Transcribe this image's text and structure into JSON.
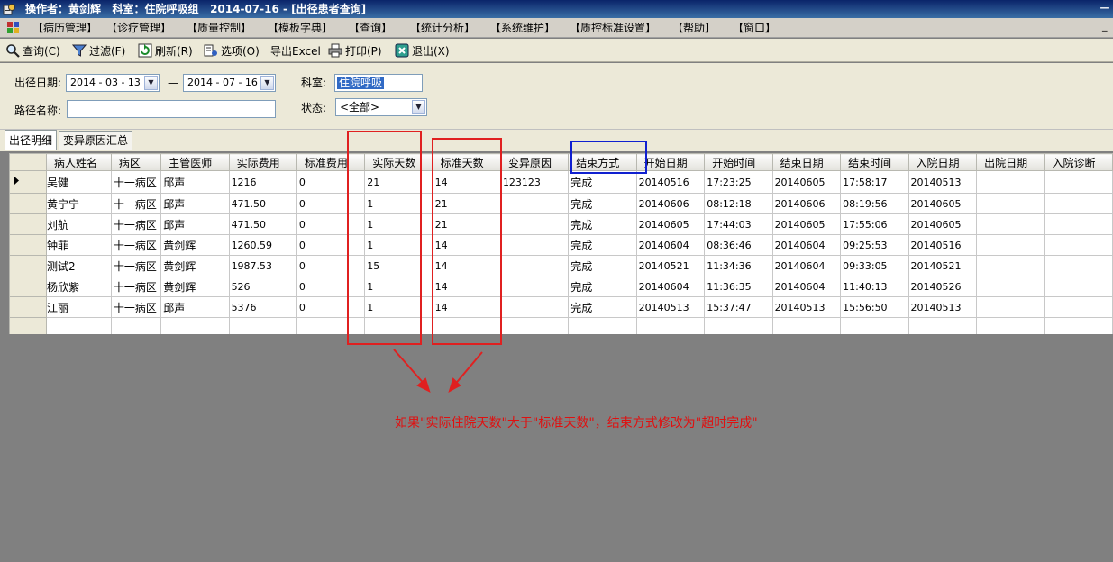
{
  "window": {
    "title": "操作者：黄剑辉   科室：住院呼吸组   2014-07-16 - [出径患者查询]",
    "controls": [
      "—",
      "_"
    ]
  },
  "menu": {
    "items": [
      "【病历管理】",
      "【诊疗管理】",
      "【质量控制】",
      "【模板字典】",
      "【查询】",
      "【统计分析】",
      "【系统维护】",
      "【质控标准设置】",
      "【帮助】",
      "【窗口】"
    ]
  },
  "toolbar": {
    "query": "查询(C)",
    "filter": "过滤(F)",
    "refresh": "刷新(R)",
    "options": "选项(O)",
    "export": "导出Excel",
    "print": "打印(P)",
    "exit": "退出(X)"
  },
  "filter": {
    "date_label": "出径日期:",
    "date_from": "2014 - 03 - 13",
    "date_sep": "—",
    "date_to": "2014 - 07 - 16",
    "dept_label": "科室:",
    "dept_value": "住院呼吸",
    "path_label": "路径名称:",
    "path_value": "",
    "status_label": "状态:",
    "status_value": "<全部>"
  },
  "tabs": [
    "出径明细",
    "变异原因汇总"
  ],
  "table": {
    "columns": [
      "病人姓名",
      "病区",
      "主管医师",
      "实际费用",
      "标准费用",
      "实际天数",
      "标准天数",
      "变异原因",
      "结束方式",
      "开始日期",
      "开始时间",
      "结束日期",
      "结束时间",
      "入院日期",
      "出院日期",
      "入院诊断"
    ],
    "rows": [
      [
        "吴健",
        "十一病区",
        "邱声",
        "1216",
        "0",
        "21",
        "14",
        "123123",
        "完成",
        "20140516",
        "17:23:25",
        "20140605",
        "17:58:17",
        "20140513",
        "",
        ""
      ],
      [
        "黄宁宁",
        "十一病区",
        "邱声",
        "471.50",
        "0",
        "1",
        "21",
        "",
        "完成",
        "20140606",
        "08:12:18",
        "20140606",
        "08:19:56",
        "20140605",
        "",
        ""
      ],
      [
        "刘航",
        "十一病区",
        "邱声",
        "471.50",
        "0",
        "1",
        "21",
        "",
        "完成",
        "20140605",
        "17:44:03",
        "20140605",
        "17:55:06",
        "20140605",
        "",
        ""
      ],
      [
        "钟菲",
        "十一病区",
        "黄剑辉",
        "1260.59",
        "0",
        "1",
        "14",
        "",
        "完成",
        "20140604",
        "08:36:46",
        "20140604",
        "09:25:53",
        "20140516",
        "",
        ""
      ],
      [
        "测试2",
        "十一病区",
        "黄剑辉",
        "1987.53",
        "0",
        "15",
        "14",
        "",
        "完成",
        "20140521",
        "11:34:36",
        "20140604",
        "09:33:05",
        "20140521",
        "",
        ""
      ],
      [
        "杨欣紫",
        "十一病区",
        "黄剑辉",
        "526",
        "0",
        "1",
        "14",
        "",
        "完成",
        "20140604",
        "11:36:35",
        "20140604",
        "11:40:13",
        "20140526",
        "",
        ""
      ],
      [
        "江丽",
        "十一病区",
        "邱声",
        "5376",
        "0",
        "1",
        "14",
        "",
        "完成",
        "20140513",
        "15:37:47",
        "20140513",
        "15:56:50",
        "20140513",
        "",
        ""
      ]
    ]
  },
  "annotation": {
    "text": "如果\"实际住院天数\"大于\"标准天数\"，结束方式修改为\"超时完成\"",
    "color": "#e01010",
    "highlight_color": "#1020d0"
  }
}
